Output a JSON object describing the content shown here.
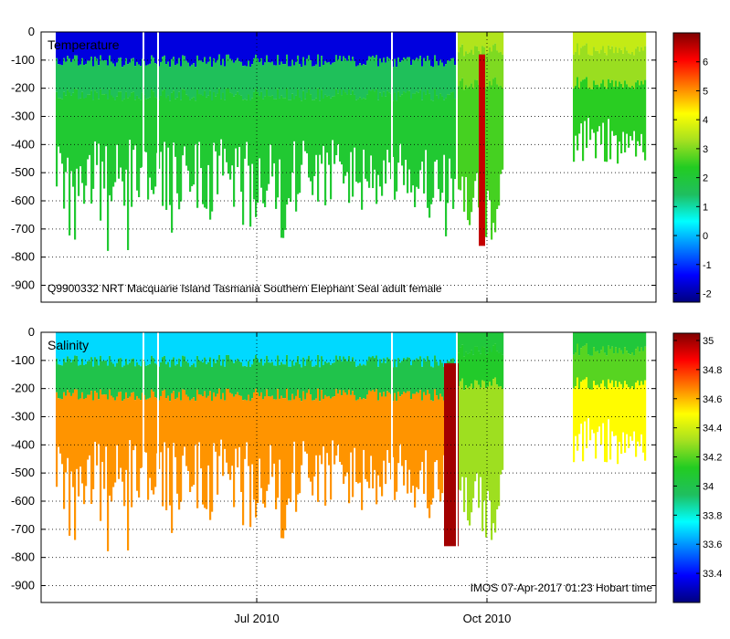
{
  "chart_data": [
    {
      "type": "heatmap",
      "panel_label": "Temperature",
      "annotation": "Q9900332 NRT Macquarie Island Tasmania Southern Elephant Seal adult female",
      "y_ticks": [
        0,
        -100,
        -200,
        -300,
        -400,
        -500,
        -600,
        -700,
        -800,
        -900
      ],
      "y_ticklabels": [
        "0",
        "-100",
        "-200",
        "-300",
        "-400",
        "-500",
        "-600",
        "-700",
        "-800",
        "-900"
      ],
      "ylim": [
        -960,
        0
      ],
      "x_ticklabels": [],
      "grid": true,
      "colorbar": {
        "min": -2.3,
        "max": 7,
        "ticks": [
          -2,
          -1,
          0,
          1,
          2,
          3,
          4,
          5,
          6
        ],
        "ticklabels": [
          "-2",
          "-1",
          "0",
          "1",
          "2",
          "3",
          "4",
          "5",
          "6"
        ],
        "colormap": [
          "#00007f",
          "#0000ff",
          "#007fff",
          "#00ffff",
          "#1fbf5f",
          "#22cc22",
          "#a5e020",
          "#ffff00",
          "#ff7f00",
          "#ff0000",
          "#7f0000"
        ]
      },
      "layers": [
        {
          "name": "surface",
          "value": -1.6,
          "color": "#0a0a96"
        },
        {
          "name": "upper",
          "value": 1.5,
          "color": "#1fc36c"
        },
        {
          "name": "deep",
          "value": 2.1,
          "color": "#24bf58"
        }
      ]
    },
    {
      "type": "heatmap",
      "panel_label": "Salinity",
      "annotation": "IMOS 07-Apr-2017 01:23 Hobart time",
      "y_ticks": [
        0,
        -100,
        -200,
        -300,
        -400,
        -500,
        -600,
        -700,
        -800,
        -900
      ],
      "y_ticklabels": [
        "0",
        "-100",
        "-200",
        "-300",
        "-400",
        "-500",
        "-600",
        "-700",
        "-800",
        "-900"
      ],
      "ylim": [
        -960,
        0
      ],
      "x_ticklabels": [
        "Jul 2010",
        "Oct 2010"
      ],
      "grid": true,
      "colorbar": {
        "min": 33.2,
        "max": 35.05,
        "ticks": [
          33.4,
          33.6,
          33.8,
          34,
          34.2,
          34.4,
          34.6,
          34.8,
          35
        ],
        "ticklabels": [
          "33.4",
          "33.6",
          "33.8",
          "34",
          "34.2",
          "34.4",
          "34.6",
          "34.8",
          "35"
        ],
        "colormap": [
          "#00007f",
          "#0000ff",
          "#007fff",
          "#00ffff",
          "#1fbf5f",
          "#22cc22",
          "#a5e020",
          "#ffff00",
          "#ff7f00",
          "#ff0000",
          "#7f0000"
        ]
      },
      "layers": [
        {
          "name": "surface",
          "value": 33.7,
          "color": "#1b8ff0"
        },
        {
          "name": "upper",
          "value": 34.0,
          "color": "#22c060"
        },
        {
          "name": "deep",
          "value": 34.65,
          "color": "#f6b020"
        }
      ]
    }
  ]
}
